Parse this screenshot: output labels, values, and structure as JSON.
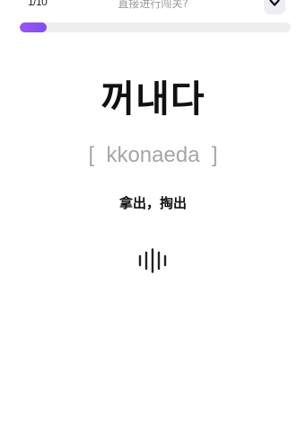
{
  "header": {
    "counter": "1/10",
    "skip_prompt": "直接进行闯关?",
    "collapse_icon": "chevron-down-icon"
  },
  "progress": {
    "current": 1,
    "total": 10,
    "fraction": 0.1,
    "accent": "#8b52f2",
    "track": "#eeeeef"
  },
  "card": {
    "word": "꺼내다",
    "romanization": "[  kkonaeda  ]",
    "meaning": "拿出，掏出",
    "audio_icon": "audio-waveform-icon"
  }
}
